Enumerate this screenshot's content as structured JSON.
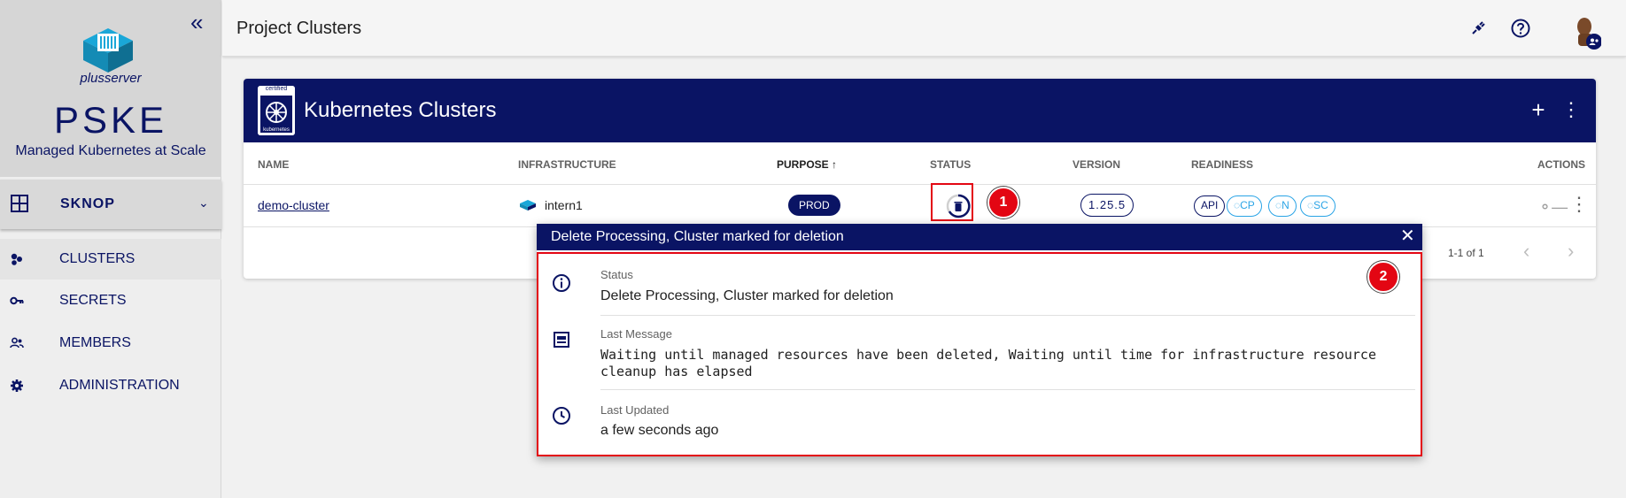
{
  "sidebar": {
    "brand_logo_text": "plusserver",
    "brand_title": "PSKE",
    "brand_subtitle": "Managed Kubernetes at Scale",
    "project": "SKNOP",
    "items": [
      {
        "label": "CLUSTERS",
        "icon": "clusters-icon"
      },
      {
        "label": "SECRETS",
        "icon": "key-icon"
      },
      {
        "label": "MEMBERS",
        "icon": "members-icon"
      },
      {
        "label": "ADMINISTRATION",
        "icon": "gear-icon"
      }
    ]
  },
  "topbar": {
    "title": "Project Clusters"
  },
  "card": {
    "title": "Kubernetes Clusters",
    "badge_top": "certified",
    "badge_bottom": "kubernetes",
    "columns": {
      "name": "NAME",
      "infrastructure": "INFRASTRUCTURE",
      "purpose": "PURPOSE",
      "status": "STATUS",
      "version": "VERSION",
      "readiness": "READINESS",
      "actions": "ACTIONS"
    },
    "row": {
      "name": "demo-cluster",
      "infrastructure": "intern1",
      "purpose": "PROD",
      "version": "1.25.5",
      "readiness": [
        "API",
        "CP",
        "N",
        "SC"
      ]
    },
    "pagination": "1-1 of 1"
  },
  "annotations": {
    "one": "1",
    "two": "2"
  },
  "popup": {
    "title": "Delete Processing, Cluster marked for deletion",
    "status_label": "Status",
    "status_value": "Delete Processing, Cluster marked for deletion",
    "message_label": "Last Message",
    "message_value": "Waiting until managed resources have been deleted, Waiting until time for infrastructure resource cleanup has elapsed",
    "updated_label": "Last Updated",
    "updated_value": "a few seconds ago"
  },
  "colors": {
    "primary": "#0a1464",
    "accent": "#2aa4e6",
    "annotation": "#e30613"
  }
}
